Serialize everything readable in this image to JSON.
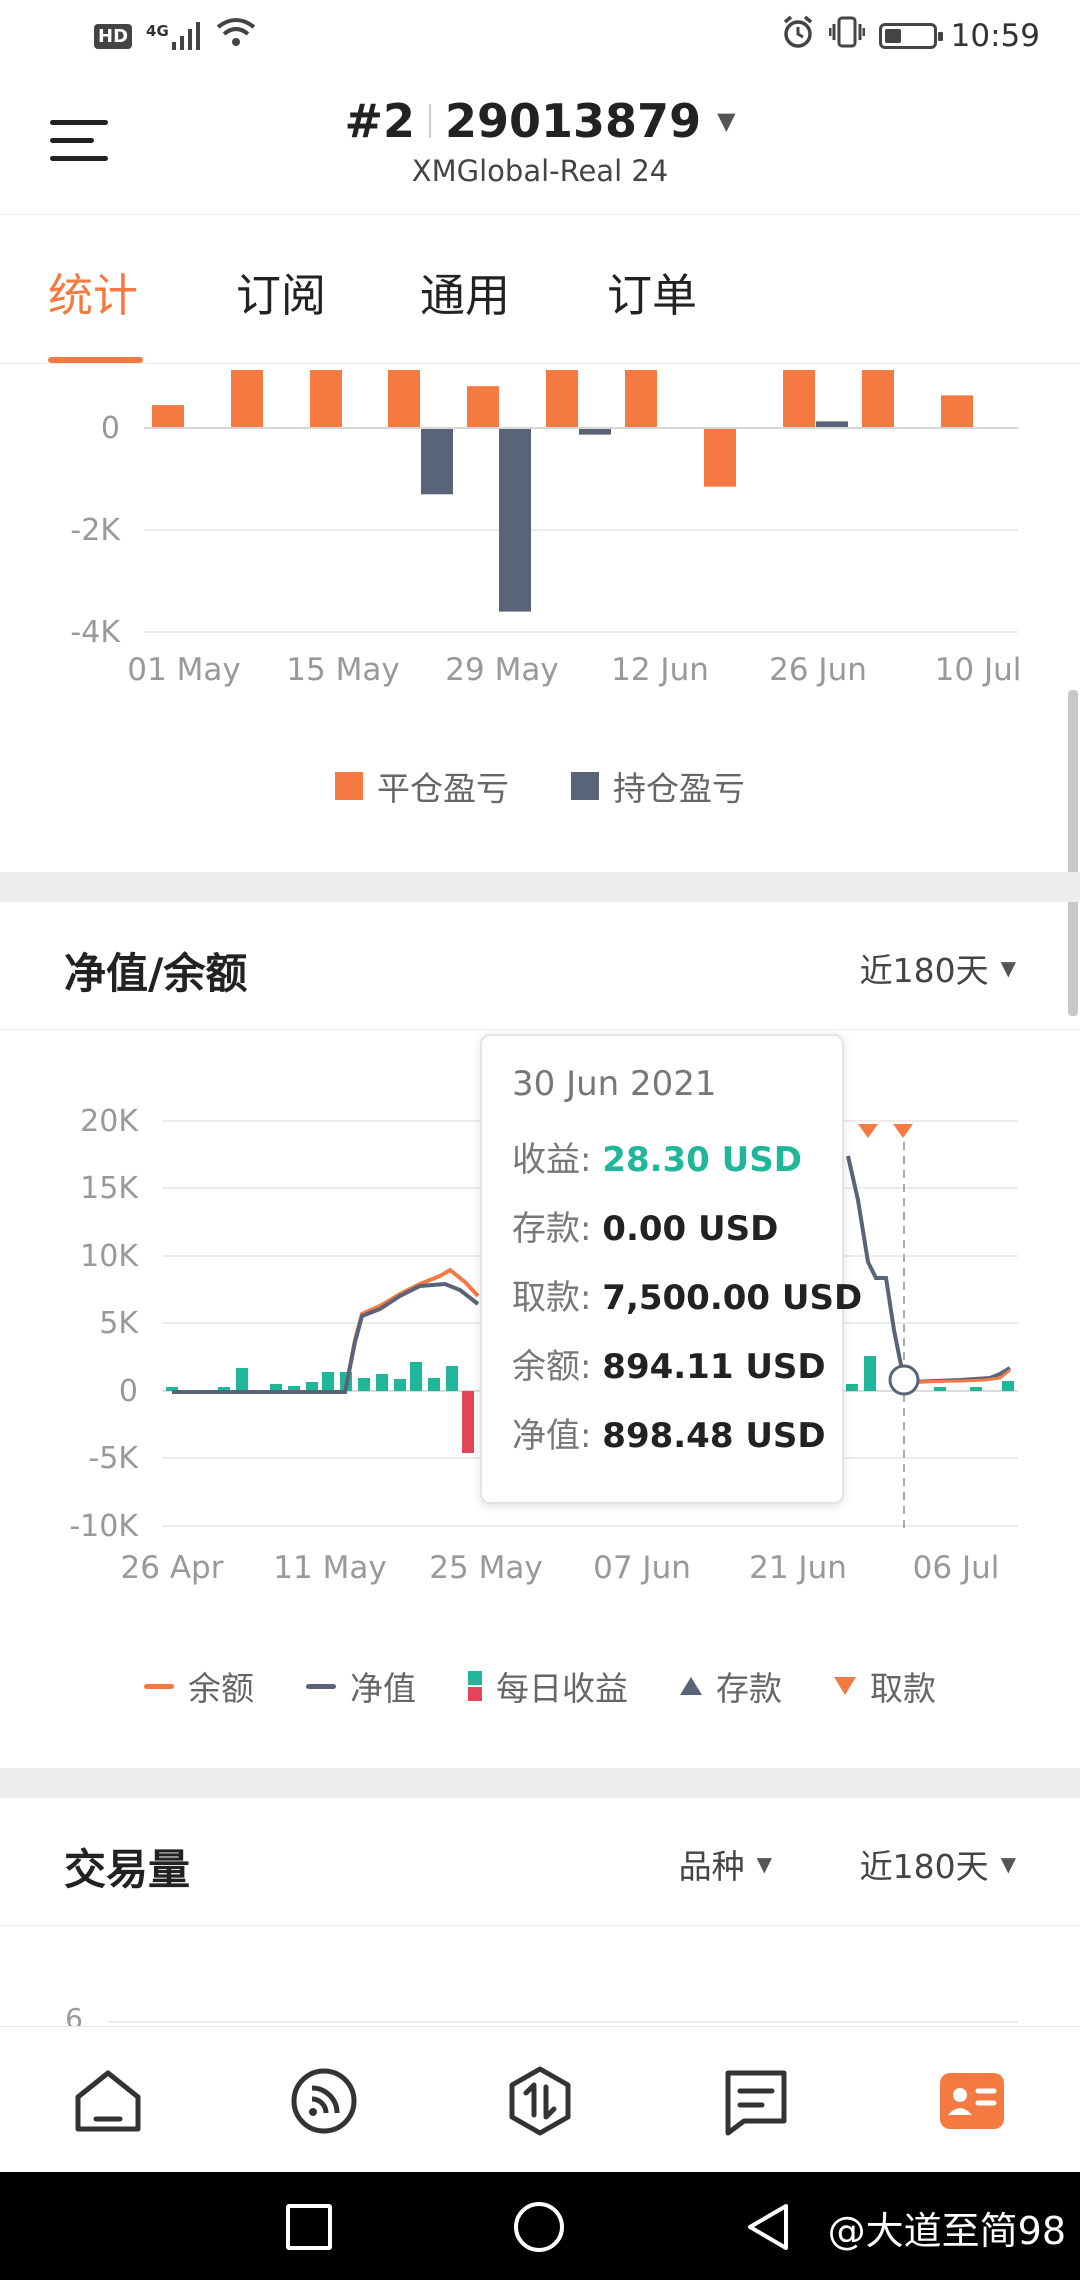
{
  "status_bar": {
    "left_icons": [
      "hd-icon",
      "signal-4g-icon",
      "wifi-icon"
    ],
    "hd": "HD",
    "network": "4G",
    "right_icons": [
      "alarm-icon",
      "vibrate-icon",
      "battery-icon"
    ],
    "time": "10:59",
    "battery_level": 0.35
  },
  "header": {
    "account_index": "#2",
    "account_number": "29013879",
    "server": "XMGlobal-Real 24"
  },
  "tabs": [
    "统计",
    "订阅",
    "通用",
    "订单"
  ],
  "active_tab": 0,
  "accent_color": "#f47a42",
  "pnl_chart": {
    "chart_data": {
      "type": "bar",
      "y_ticks": [
        "0",
        "-2K",
        "-4K"
      ],
      "x_ticks": [
        "01 May",
        "15 May",
        "29 May",
        "12 Jun",
        "26 Jun",
        "10 Jul"
      ],
      "ylim": [
        -4000,
        1200
      ],
      "grid": true,
      "legend": "bottom",
      "series": [
        {
          "name": "平仓盈亏",
          "color": "#f47a42",
          "values": [
            450,
            1200,
            1200,
            1200,
            820,
            1200,
            1200,
            -1150,
            1200,
            1200,
            640
          ]
        },
        {
          "name": "持仓盈亏",
          "color": "#5a6478",
          "values": [
            -1300,
            -3600,
            -130,
            130
          ]
        }
      ]
    }
  },
  "equity_section": {
    "title": "净值/余额",
    "range": "近180天"
  },
  "equity_chart": {
    "chart_data": {
      "type": "line",
      "y_ticks": [
        "20K",
        "15K",
        "10K",
        "5K",
        "0",
        "-5K",
        "-10K"
      ],
      "x_ticks": [
        "26 Apr",
        "11 May",
        "25 May",
        "07 Jun",
        "21 Jun",
        "06 Jul"
      ],
      "ylim": [
        -10000,
        20000
      ],
      "grid": true,
      "legend": "bottom",
      "series": [
        {
          "name": "余额",
          "color": "#f47a42"
        },
        {
          "name": "净值",
          "color": "#5a6478"
        },
        {
          "name": "每日收益",
          "colors": [
            "#1fb69a",
            "#e5455a"
          ]
        },
        {
          "name": "存款",
          "color": "#5a6478"
        },
        {
          "name": "取款",
          "color": "#f47a42"
        }
      ]
    }
  },
  "tooltip": {
    "date": "30 Jun 2021",
    "rows": [
      {
        "label": "收益:",
        "value": "28.30 USD"
      },
      {
        "label": "存款:",
        "value": "0.00 USD"
      },
      {
        "label": "取款:",
        "value": "7,500.00 USD"
      },
      {
        "label": "余额:",
        "value": "894.11 USD"
      },
      {
        "label": "净值:",
        "value": "898.48 USD"
      }
    ]
  },
  "volume_section": {
    "title": "交易量",
    "filter": "品种",
    "range": "近180天",
    "first_tick": "6"
  },
  "bottom_nav": {
    "items": [
      "home-icon",
      "signals-feed-icon",
      "trade-icon",
      "news-icon",
      "profile-card-icon"
    ],
    "active": 4
  },
  "system_nav": {
    "watermark": "@大道至简98"
  }
}
